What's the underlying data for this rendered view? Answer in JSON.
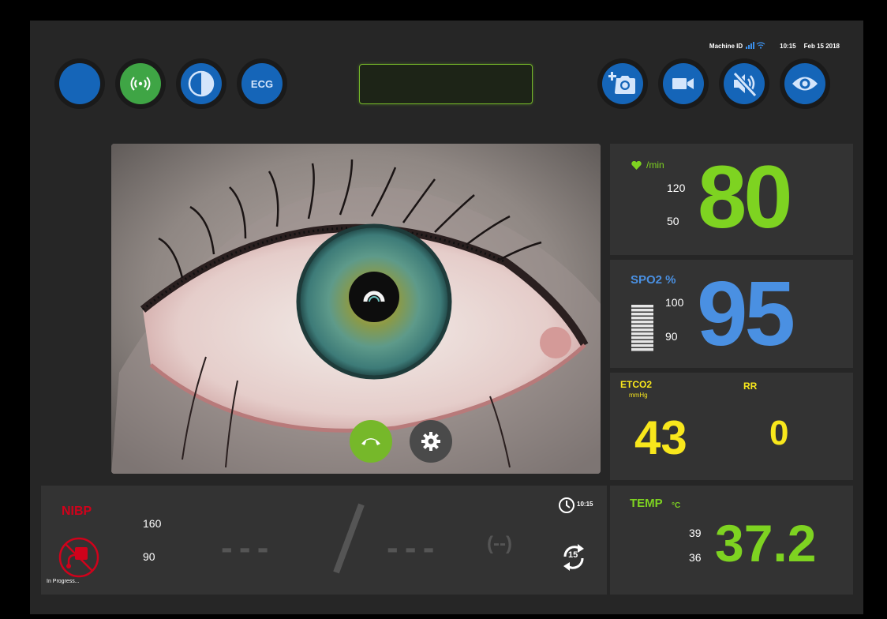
{
  "status_bar": {
    "machine_id_label": "Machine ID",
    "time": "10:15",
    "date": "Feb 15 2018"
  },
  "toolbar": {
    "ecg_label": "ECG"
  },
  "heart_rate": {
    "unit": "/min",
    "high": "120",
    "low": "50",
    "value": "80",
    "color": "#7ed321"
  },
  "spo2": {
    "label": "SPO2 %",
    "high": "100",
    "low": "90",
    "value": "95",
    "color": "#4a90e2"
  },
  "etco2": {
    "label": "ETCO2",
    "unit": "mmHg",
    "value": "43",
    "color": "#f8e71c"
  },
  "rr": {
    "label": "RR",
    "value": "0"
  },
  "temp": {
    "label": "TEMP",
    "unit": "°C",
    "high": "39",
    "low": "36",
    "value": "37.2"
  },
  "nibp": {
    "label": "NIBP",
    "high": "160",
    "low": "90",
    "systolic": "- - -",
    "diastolic": "- - -",
    "mean": "(--)",
    "status": "In Progress...",
    "time": "10:15",
    "interval": "15",
    "color": "#d0021b"
  }
}
